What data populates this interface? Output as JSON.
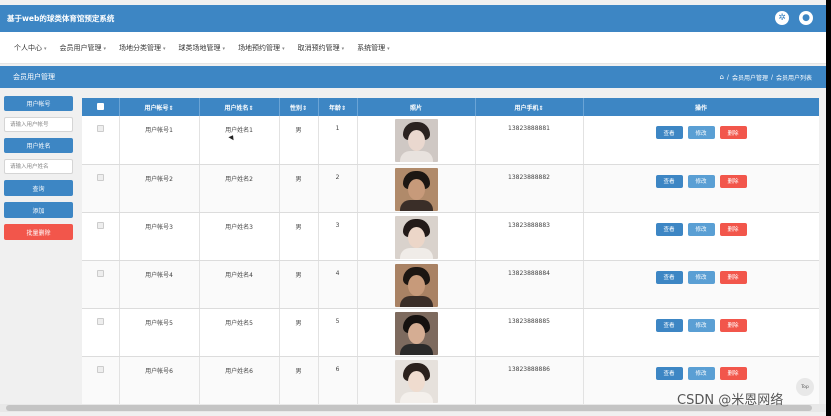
{
  "app": {
    "title": "基于web的球类体育馆预定系统"
  },
  "nav": [
    {
      "label": "个人中心"
    },
    {
      "label": "会员用户管理"
    },
    {
      "label": "场地分类管理"
    },
    {
      "label": "球类场地管理"
    },
    {
      "label": "场地预约管理"
    },
    {
      "label": "取消预约管理"
    },
    {
      "label": "系统管理"
    }
  ],
  "breadcrumb": {
    "section_title": "会员用户管理",
    "path": [
      "会员用户管理",
      "会员用户列表"
    ],
    "separator": "/"
  },
  "search": {
    "account_label": "用户帐号",
    "account_placeholder": "请输入用户帐号",
    "name_label": "用户姓名",
    "name_placeholder": "请输入用户姓名",
    "query_button": "查询",
    "add_button": "添加",
    "batch_delete_button": "批量删除"
  },
  "table": {
    "headers": [
      "用户帐号",
      "用户姓名",
      "性别",
      "年龄",
      "照片",
      "用户手机",
      "操作"
    ],
    "actions": {
      "view": "查看",
      "edit": "修改",
      "delete": "删除"
    },
    "rows": [
      {
        "account": "用户帐号1",
        "name": "用户姓名1",
        "gender": "男",
        "age": "1",
        "phone": "13823888881"
      },
      {
        "account": "用户帐号2",
        "name": "用户姓名2",
        "gender": "男",
        "age": "2",
        "phone": "13823888882"
      },
      {
        "account": "用户帐号3",
        "name": "用户姓名3",
        "gender": "男",
        "age": "3",
        "phone": "13823888883"
      },
      {
        "account": "用户帐号4",
        "name": "用户姓名4",
        "gender": "男",
        "age": "4",
        "phone": "13823888884"
      },
      {
        "account": "用户帐号5",
        "name": "用户姓名5",
        "gender": "男",
        "age": "5",
        "phone": "13823888885"
      },
      {
        "account": "用户帐号6",
        "name": "用户姓名6",
        "gender": "男",
        "age": "6",
        "phone": "13823888886"
      }
    ]
  },
  "misc": {
    "back_to_top": "Top",
    "watermark": "CSDN @米恩网络"
  },
  "colors": {
    "primary": "#3d86c4",
    "danger": "#f2564b"
  }
}
